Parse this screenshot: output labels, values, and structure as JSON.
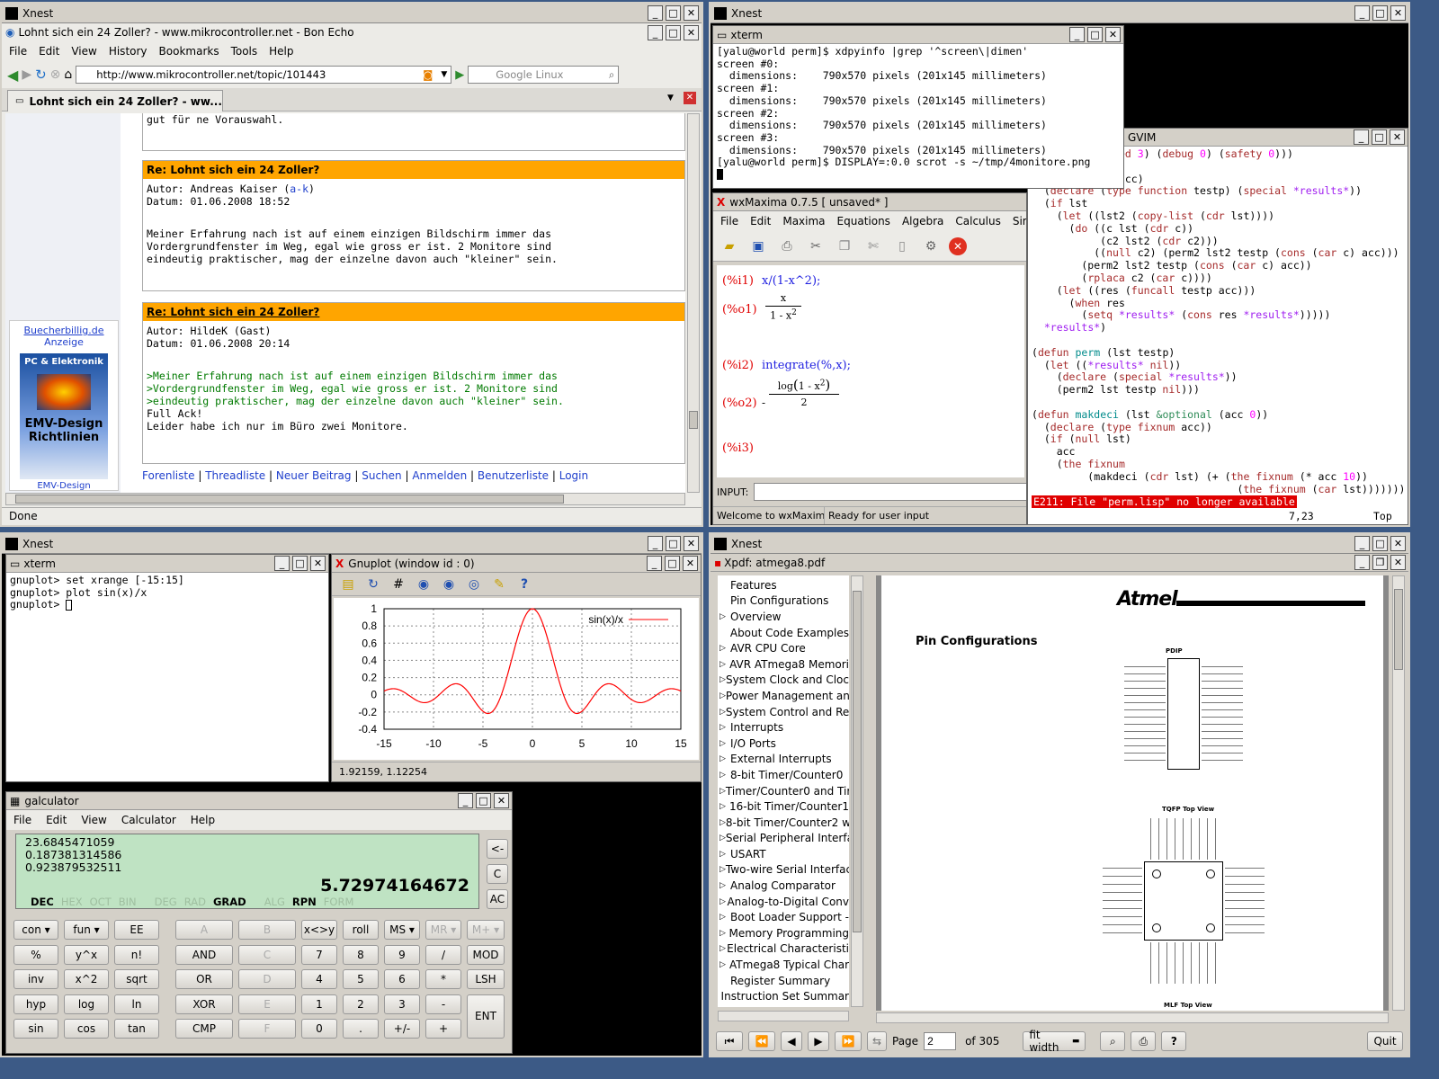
{
  "xnest": {
    "title": "Xnest"
  },
  "browser": {
    "title": "Lohnt sich ein 24 Zoller? - www.mikrocontroller.net - Bon Echo",
    "menu": [
      "File",
      "Edit",
      "View",
      "History",
      "Bookmarks",
      "Tools",
      "Help"
    ],
    "url": "http://www.mikrocontroller.net/topic/101443",
    "search_placeholder": "Google Linux",
    "tab": "Lohnt sich ein 24 Zoller? - ww...",
    "prev_text": "gut für ne Vorauswahl.",
    "posts": [
      {
        "header": "Re: Lohnt sich ein 24 Zoller?",
        "author_prefix": "Autor: Andreas Kaiser (",
        "author_link": "a-k",
        "author_suffix": ")",
        "date": "Datum: 01.06.2008 18:52",
        "body": [
          "Meiner Erfahrung nach ist auf einem einzigen Bildschirm immer das",
          "Vordergrundfenster im Weg, egal wie gross er ist. 2 Monitore sind",
          "eindeutig praktischer, mag der einzelne davon auch \"kleiner\" sein."
        ]
      },
      {
        "header": "Re: Lohnt sich ein 24 Zoller?",
        "author": "Autor: HildeK (Gast)",
        "date": "Datum: 01.06.2008 20:14",
        "quote": [
          ">Meiner Erfahrung nach ist auf einem einzigen Bildschirm immer das",
          ">Vordergrundfenster im Weg, egal wie gross er ist. 2 Monitore sind",
          ">eindeutig praktischer, mag der einzelne davon auch \"kleiner\" sein."
        ],
        "body": [
          "Full Ack!",
          "Leider habe ich nur im Büro zwei Monitore."
        ]
      }
    ],
    "ad_title": "Buecherbillig.de",
    "ad_sub": "Anzeige",
    "book_title1": "PC & Elektronik",
    "book_title2": "EMV-Design",
    "book_title3": "Richtlinien",
    "book_cut": "EMV-Design",
    "links": [
      "Forenliste",
      "Threadliste",
      "Neuer Beitrag",
      "Suchen",
      "Anmelden",
      "Benutzerliste",
      "Login"
    ],
    "status": "Done"
  },
  "xterm1": {
    "title": "xterm",
    "lines": [
      "[yalu@world perm]$ xdpyinfo |grep '^screen\\|dimen'",
      "screen #0:",
      "  dimensions:    790x570 pixels (201x145 millimeters)",
      "screen #1:",
      "  dimensions:    790x570 pixels (201x145 millimeters)",
      "screen #2:",
      "  dimensions:    790x570 pixels (201x145 millimeters)",
      "screen #3:",
      "  dimensions:    790x570 pixels (201x145 millimeters)",
      "[yalu@world perm]$ DISPLAY=:0.0 scrot -s ~/tmp/4monitore.png"
    ]
  },
  "gvim": {
    "title": "rojekte/prg/lisp) - GVIM",
    "error": "E211: File \"perm.lisp\" no longer available",
    "pos": "7,23",
    "scroll": "Top"
  },
  "wxmaxima": {
    "title": "wxMaxima 0.7.5 [ unsaved* ]",
    "menu": [
      "File",
      "Edit",
      "Maxima",
      "Equations",
      "Algebra",
      "Calculus",
      "Simpl"
    ],
    "i1_label": "(%i1)",
    "i1": "x/(1-x^2);",
    "o1_label": "(%o1)",
    "o1_num": "x",
    "o1_den": "1 - x",
    "o1_exp": "2",
    "i2_label": "(%i2)",
    "i2": "integrate(%,x);",
    "o2_label": "(%o2)",
    "o2_minus": "-",
    "o2_log": "log",
    "o2_arg": "1 - x",
    "o2_exp": "2",
    "o2_den": "2",
    "i3_label": "(%i3)",
    "input_label": "INPUT:",
    "status1": "Welcome to wxMaxim",
    "status2": "Ready for user input"
  },
  "xterm2": {
    "title": "xterm",
    "lines": [
      "gnuplot> set xrange [-15:15]",
      "gnuplot> plot sin(x)/x",
      "gnuplot> "
    ]
  },
  "gnuplot": {
    "title": "Gnuplot (window id : 0)",
    "coords": "1.92159,  1.12254"
  },
  "chart_data": {
    "type": "line",
    "title": "",
    "xlabel": "",
    "ylabel": "",
    "xlim": [
      -15,
      15
    ],
    "ylim": [
      -0.4,
      1
    ],
    "xticks": [
      "-15",
      "-10",
      "-5",
      "0",
      "5",
      "10",
      "15"
    ],
    "yticks": [
      "1",
      "0.8",
      "0.6",
      "0.4",
      "0.2",
      "0",
      "-0.2",
      "-0.4"
    ],
    "grid": true,
    "legend": "top-right",
    "series": [
      {
        "name": "sin(x)/x",
        "color": "#ff0000",
        "function": "sin(x)/x"
      }
    ]
  },
  "galculator": {
    "title": "galculator",
    "menu": [
      "File",
      "Edit",
      "View",
      "Calculator",
      "Help"
    ],
    "stack": [
      "23.6845471059",
      "0.187381314586",
      "0.923879532511"
    ],
    "display": "5.72974164672",
    "modes": [
      "DEC",
      "HEX",
      "OCT",
      "BIN",
      "DEG",
      "RAD",
      "GRAD",
      "ALG",
      "RPN",
      "FORM"
    ],
    "side": [
      "<-",
      "C",
      "AC"
    ],
    "rows": [
      [
        "con ▾",
        "fun ▾",
        "EE",
        "A",
        "B",
        "x<>y",
        "roll",
        "MS ▾",
        "MR ▾",
        "M+ ▾"
      ],
      [
        "%",
        "y^x",
        "n!",
        "AND",
        "C",
        "7",
        "8",
        "9",
        "/",
        "MOD"
      ],
      [
        "inv",
        "x^2",
        "sqrt",
        "OR",
        "D",
        "4",
        "5",
        "6",
        "*",
        "LSH"
      ],
      [
        "hyp",
        "log",
        "ln",
        "XOR",
        "E",
        "1",
        "2",
        "3",
        "-",
        ""
      ],
      [
        "sin",
        "cos",
        "tan",
        "CMP",
        "F",
        "0",
        ".",
        "+/-",
        "+",
        "ENT"
      ]
    ]
  },
  "xpdf": {
    "title": "Xpdf: atmega8.pdf",
    "toc": [
      {
        "arrow": false,
        "label": "Features"
      },
      {
        "arrow": false,
        "label": "Pin Configurations"
      },
      {
        "arrow": true,
        "label": "Overview"
      },
      {
        "arrow": false,
        "label": "About Code Examples"
      },
      {
        "arrow": true,
        "label": "AVR CPU Core"
      },
      {
        "arrow": true,
        "label": "AVR ATmega8 Memori"
      },
      {
        "arrow": true,
        "label": "System Clock and Cloc"
      },
      {
        "arrow": true,
        "label": "Power Management an"
      },
      {
        "arrow": true,
        "label": "System Control and Re"
      },
      {
        "arrow": true,
        "label": "Interrupts"
      },
      {
        "arrow": true,
        "label": "I/O Ports"
      },
      {
        "arrow": true,
        "label": "External Interrupts"
      },
      {
        "arrow": true,
        "label": "8-bit Timer/Counter0"
      },
      {
        "arrow": true,
        "label": "Timer/Counter0 and Tir"
      },
      {
        "arrow": true,
        "label": "16-bit Timer/Counter1"
      },
      {
        "arrow": true,
        "label": "8-bit Timer/Counter2 w"
      },
      {
        "arrow": true,
        "label": "Serial Peripheral Interfa"
      },
      {
        "arrow": true,
        "label": "USART"
      },
      {
        "arrow": true,
        "label": "Two-wire Serial Interfac"
      },
      {
        "arrow": true,
        "label": "Analog Comparator"
      },
      {
        "arrow": true,
        "label": "Analog-to-Digital Conv"
      },
      {
        "arrow": true,
        "label": "Boot Loader Support -"
      },
      {
        "arrow": true,
        "label": "Memory Programming"
      },
      {
        "arrow": true,
        "label": "Electrical Characteristi"
      },
      {
        "arrow": true,
        "label": "ATmega8 Typical Char"
      },
      {
        "arrow": false,
        "label": "Register Summary"
      },
      {
        "arrow": false,
        "label": "Instruction Set Summar"
      }
    ],
    "page_heading": "Pin Configurations",
    "logo": "Atmel",
    "pdip": "PDIP",
    "tqfp": "TQFP Top View",
    "mlf": "MLF Top View",
    "page_label": "Page",
    "page_value": "2",
    "page_total": "of 305",
    "zoom": "fit width",
    "quit": "Quit"
  }
}
